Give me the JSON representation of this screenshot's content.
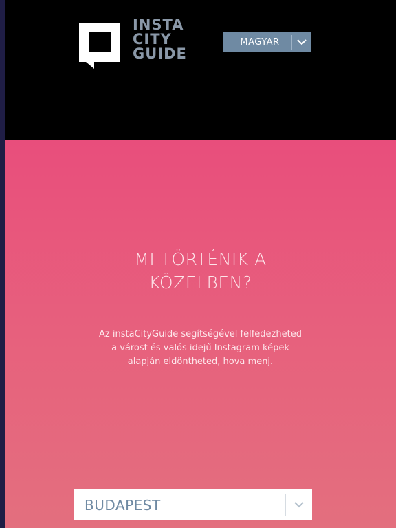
{
  "header": {
    "logo_lines": [
      "INSTA",
      "CITY",
      "GUIDE"
    ],
    "language_select": {
      "selected": "MAGYAR",
      "icon": "chevron-down-icon"
    }
  },
  "hero": {
    "title_lines": [
      "MI TÖRTÉNIK A",
      "KÖZELBEN?"
    ],
    "description_lines": [
      "Az instaCityGuide segítségével felfedezheted",
      "a várost és valós idejű Instagram képek",
      "alapján eldöntheted, hova menj."
    ],
    "city_select": {
      "selected": "BUDAPEST",
      "icon": "chevron-down-icon"
    }
  },
  "colors": {
    "header_bg": "#000000",
    "logo_text": "#8a98a8",
    "language_select_bg": "#6f8aa3",
    "hero_gradient_top": "#e84e7c",
    "hero_gradient_bottom": "#e36f7e",
    "hero_text": "#fde5ea",
    "city_select_text": "#6f8aa3"
  }
}
